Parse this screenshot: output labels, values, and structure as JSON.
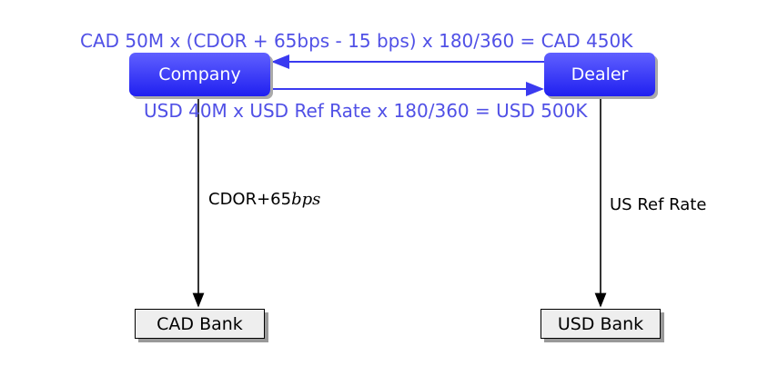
{
  "nodes": {
    "company": "Company",
    "dealer": "Dealer",
    "cad_bank": "CAD Bank",
    "usd_bank": "USD Bank"
  },
  "flows": {
    "top": "CAD 50M x (CDOR + 65bps - 15 bps) x 180/360 = CAD 450K",
    "bottom": "USD 40M x USD Ref Rate x 180/360 = USD 500K",
    "cad_leg_prefix": "CDOR+65",
    "cad_leg_suffix": "bps",
    "usd_leg": "US Ref Rate"
  },
  "colors": {
    "accent": "#3030f5",
    "flow_text": "#5050e6"
  }
}
